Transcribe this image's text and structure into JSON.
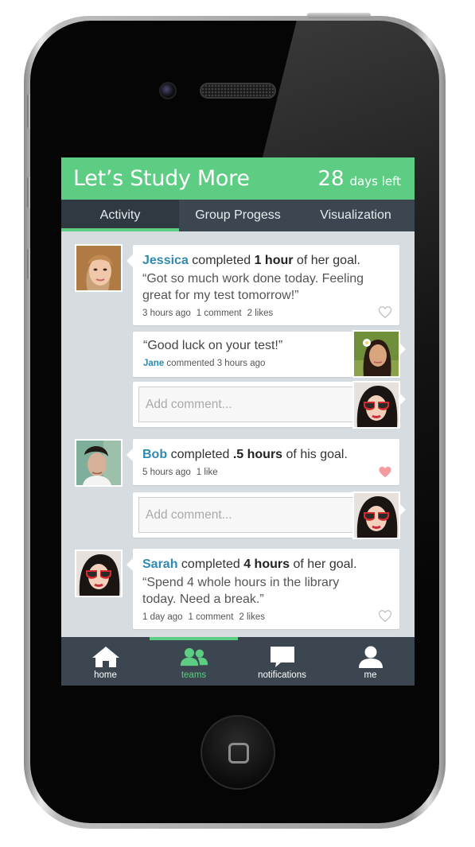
{
  "app": {
    "title": "Let’s Study More",
    "days_left_number": "28",
    "days_left_label": "days left",
    "accent_color": "#5ecd84",
    "name_color": "#2e8ab1"
  },
  "tabs": [
    {
      "label": "Activity",
      "active": true
    },
    {
      "label": "Group Progess",
      "active": false
    },
    {
      "label": "Visualization",
      "active": false
    }
  ],
  "feed": {
    "posts": [
      {
        "name": "Jessica",
        "completed_text": "completed",
        "amount": "1 hour",
        "goal_text": "of her goal.",
        "quote": "“Got so much work done today. Feeling great for my test tomorrow!”",
        "time": "3 hours ago",
        "comments": "1 comment",
        "likes": "2 likes",
        "heart": "heart-outline-icon"
      },
      {
        "name": "Bob",
        "completed_text": "completed",
        "amount": ".5 hours",
        "goal_text": "of his goal.",
        "time": "5 hours ago",
        "likes": "1 like",
        "heart": "heart-filled-icon"
      },
      {
        "name": "Sarah",
        "completed_text": "completed",
        "amount": "4 hours",
        "goal_text": "of her goal.",
        "quote": "“Spend 4 whole hours in the library today. Need a break.”",
        "time": "1 day ago",
        "comments": "1 comment",
        "likes": "2 likes",
        "heart": "heart-outline-icon"
      }
    ],
    "comment": {
      "text": "“Good luck on your test!”",
      "author": "Jane",
      "meta": "commented 3 hours ago"
    },
    "add_comment_placeholder": "Add comment..."
  },
  "bottom_nav": [
    {
      "label": "home",
      "icon": "home-icon",
      "active": false
    },
    {
      "label": "teams",
      "icon": "teams-icon",
      "active": true
    },
    {
      "label": "notifications",
      "icon": "notifications-icon",
      "active": false
    },
    {
      "label": "me",
      "icon": "user-icon",
      "active": false
    }
  ]
}
